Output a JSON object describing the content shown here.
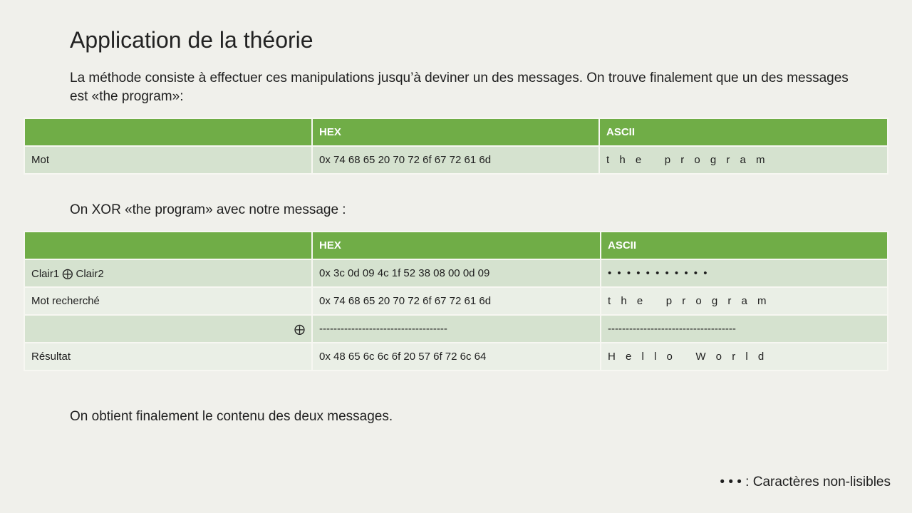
{
  "title": "Application de la théorie",
  "intro": "La méthode consiste à effectuer ces manipulations jusqu’à deviner un des messages. On trouve finalement que un des messages est «the program»:",
  "table1": {
    "headers": [
      "",
      "HEX",
      "ASCII"
    ],
    "rows": [
      [
        "Mot",
        "0x 74 68 65 20 70 72 6f 67 72 61 6d",
        "t h e   p r o g r a m"
      ]
    ]
  },
  "xor_text": "On XOR «the program» avec notre message :",
  "table2": {
    "headers": [
      "",
      "HEX",
      "ASCII"
    ],
    "rows": [
      [
        "Clair1 ⨁ Clair2",
        "0x 3c 0d 09 4c 1f 52 38 08 00 0d 09",
        "• • • • • • • • • • •"
      ],
      [
        "Mot recherché",
        "0x 74 68 65 20 70 72 6f 67 72 61 6d",
        "t h e   p r o g r a m"
      ],
      [
        "⨁",
        "------------------------------------",
        "------------------------------------"
      ],
      [
        "Résultat",
        "0x 48 65 6c 6c 6f 20 57 6f 72 6c 64",
        "H e l l o   W o r l d"
      ]
    ]
  },
  "conclusion": "On obtient finalement le contenu des deux messages.",
  "legend": "• • • : Caractères non-lisibles"
}
